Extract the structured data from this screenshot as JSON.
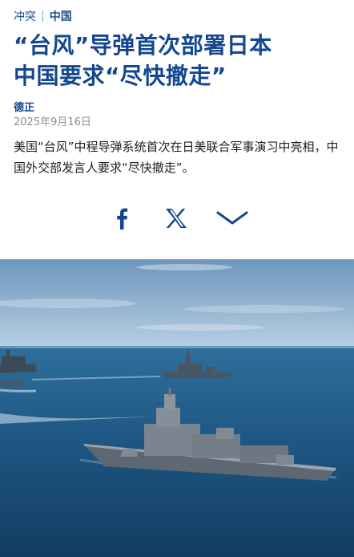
{
  "breadcrumb": {
    "section": "冲突",
    "separator": "|",
    "category": "中国"
  },
  "article": {
    "headline_line1": "“台风”导弹首次部署日本",
    "headline_line2": "中国要求“尽快撤走”",
    "author": "德正",
    "date": "2025年9月16日",
    "summary": "美国“台风”中程导弹系统首次在日美联合军事演习中亮相，中国外交部发言人要求“尽快撤走”。"
  },
  "share": {
    "facebook_icon": "facebook-icon",
    "x_icon": "x-logo-icon",
    "more_icon": "chevron-down-icon"
  },
  "photo": {
    "subject": "naval-ships-at-sea"
  },
  "colors": {
    "accent": "#14478f",
    "muted": "#8a8f96",
    "sea": "#1f5d8a",
    "sky": "#8fb2d0"
  }
}
